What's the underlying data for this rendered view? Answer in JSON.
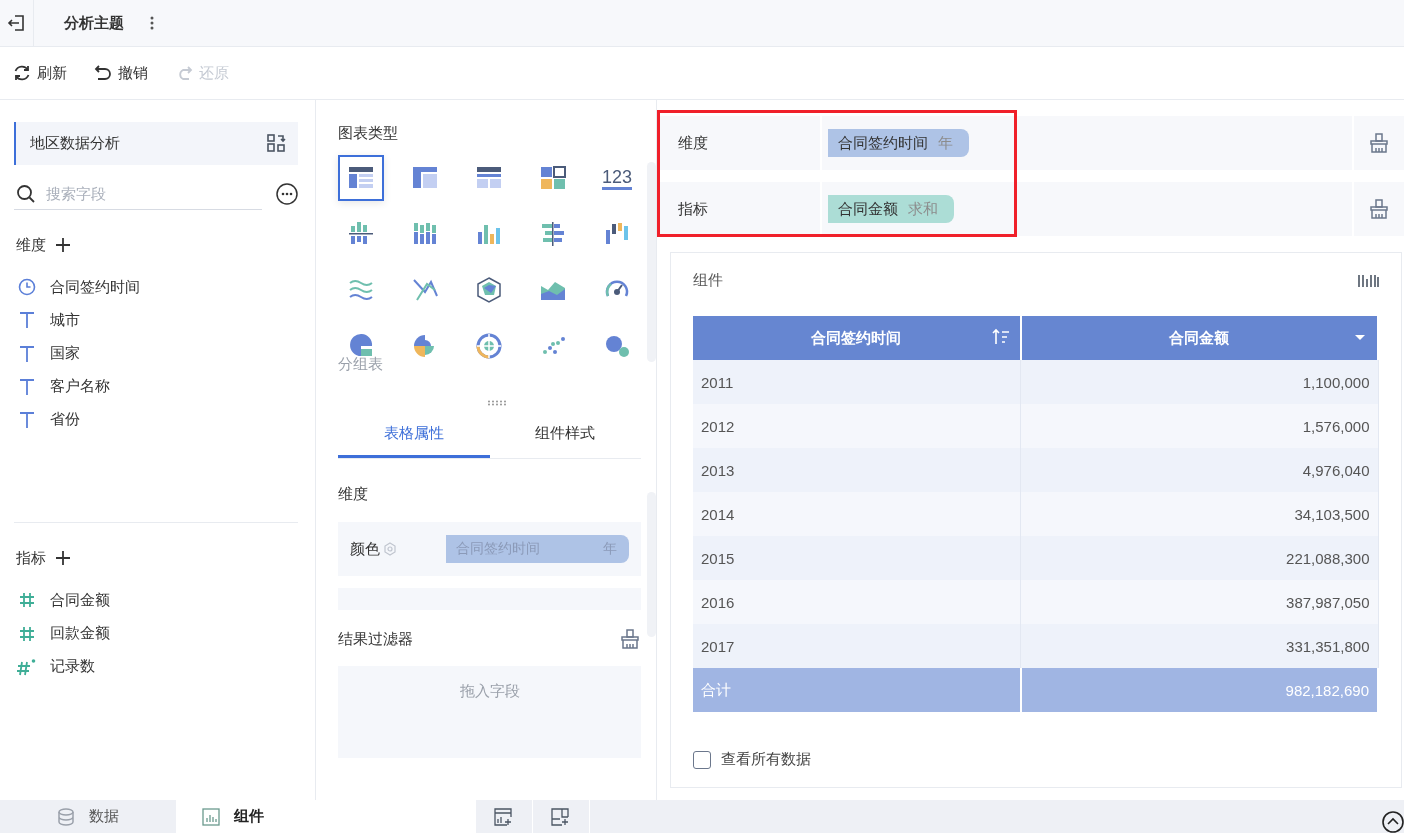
{
  "top_bar": {
    "title": "分析主题"
  },
  "toolbar": [
    {
      "label": "刷新",
      "kind": "refresh",
      "disabled": false
    },
    {
      "label": "撤销",
      "kind": "undo",
      "disabled": false
    },
    {
      "label": "还原",
      "kind": "redo",
      "disabled": true
    }
  ],
  "data_panel": {
    "dataset": "地区数据分析",
    "search": {
      "placeholder": "搜索字段"
    },
    "dimensions": {
      "title": "维度",
      "fields": [
        {
          "name": "合同签约时间",
          "kind": "date"
        },
        {
          "name": "城市",
          "kind": "text"
        },
        {
          "name": "国家",
          "kind": "text"
        },
        {
          "name": "客户名称",
          "kind": "text"
        },
        {
          "name": "省份",
          "kind": "text"
        }
      ]
    },
    "metrics": {
      "title": "指标",
      "fields": [
        {
          "name": "合同金额",
          "kind": "number"
        },
        {
          "name": "回款金额",
          "kind": "number"
        },
        {
          "name": "记录数",
          "kind": "count"
        }
      ]
    }
  },
  "chart_panel": {
    "title": "图表类型",
    "chart_types": [
      {
        "kind": "grouped-table",
        "selected": true
      },
      {
        "kind": "cross-table",
        "selected": false
      },
      {
        "kind": "detail-table",
        "selected": false
      },
      {
        "kind": "card-grid",
        "selected": false
      },
      {
        "kind": "number",
        "label": "123",
        "selected": false
      },
      {
        "kind": "grouped-bar",
        "selected": false
      },
      {
        "kind": "stacked-bar",
        "selected": false
      },
      {
        "kind": "bar",
        "selected": false
      },
      {
        "kind": "horizontal-bar",
        "selected": false
      },
      {
        "kind": "range-bar",
        "selected": false
      },
      {
        "kind": "wave",
        "selected": false
      },
      {
        "kind": "line",
        "selected": false
      },
      {
        "kind": "radar",
        "selected": false
      },
      {
        "kind": "area",
        "selected": false
      },
      {
        "kind": "gauge",
        "selected": false
      },
      {
        "kind": "pie",
        "selected": false
      },
      {
        "kind": "rose",
        "selected": false
      },
      {
        "kind": "sunburst",
        "selected": false
      },
      {
        "kind": "scatter",
        "selected": false
      },
      {
        "kind": "bubble",
        "selected": false
      }
    ],
    "type_name": "分组表",
    "tabs": [
      {
        "label": "表格属性",
        "selected": true
      },
      {
        "label": "组件样式",
        "selected": false
      }
    ],
    "property_section": "维度",
    "properties": [
      {
        "label": "颜色",
        "field": "合同签约时间",
        "unit": "年"
      }
    ],
    "result_filter": {
      "title": "结果过滤器",
      "placeholder": "拖入字段"
    }
  },
  "field_wells": [
    {
      "label": "维度",
      "kind": "dimension",
      "field": "合同签约时间",
      "unit": "年"
    },
    {
      "label": "指标",
      "kind": "metric",
      "field": "合同金额",
      "unit": "求和"
    }
  ],
  "component": {
    "title": "组件",
    "table": {
      "columns": [
        {
          "label": "合同签约时间",
          "kind": "sort"
        },
        {
          "label": "合同金额",
          "kind": "menu"
        }
      ],
      "rows": [
        [
          "2011",
          "1,100,000"
        ],
        [
          "2012",
          "1,576,000"
        ],
        [
          "2013",
          "4,976,040"
        ],
        [
          "2014",
          "34,103,500"
        ],
        [
          "2015",
          "221,088,300"
        ],
        [
          "2016",
          "387,987,050"
        ],
        [
          "2017",
          "331,351,800"
        ]
      ],
      "total": [
        "合计",
        "982,182,690"
      ]
    },
    "show_all": {
      "label": "查看所有数据",
      "checked": false
    }
  },
  "bottom_tabs": [
    {
      "label": "数据",
      "kind": "data",
      "selected": false
    },
    {
      "label": "组件",
      "kind": "component",
      "selected": true
    }
  ]
}
